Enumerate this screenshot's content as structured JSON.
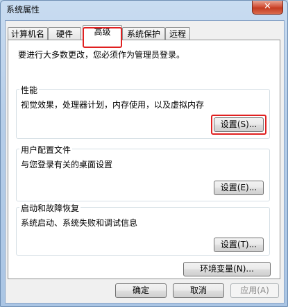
{
  "window": {
    "title": "系统属性",
    "close_glyph": "✕"
  },
  "tabs": [
    {
      "label": "计算机名",
      "active": false
    },
    {
      "label": "硬件",
      "active": false
    },
    {
      "label": "高级",
      "active": true
    },
    {
      "label": "系统保护",
      "active": false
    },
    {
      "label": "远程",
      "active": false
    }
  ],
  "advanced": {
    "intro": "要进行大多数更改，您必须作为管理员登录。",
    "performance": {
      "title": "性能",
      "description": "视觉效果，处理器计划，内存使用，以及虚拟内存",
      "button": "设置(S)..."
    },
    "user_profiles": {
      "title": "用户配置文件",
      "description": "与您登录有关的桌面设置",
      "button": "设置(E)..."
    },
    "startup_recovery": {
      "title": "启动和故障恢复",
      "description": "系统启动、系统失败和调试信息",
      "button": "设置(T)..."
    },
    "env_button": "环境变量(N)..."
  },
  "footer": {
    "ok": "确定",
    "cancel": "取消",
    "apply": "应用(A)"
  },
  "colors": {
    "highlight": "#e02020"
  }
}
